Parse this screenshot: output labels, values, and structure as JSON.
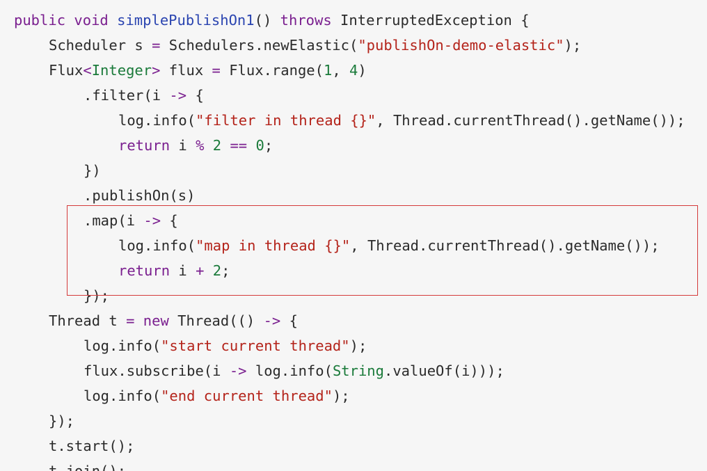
{
  "code": {
    "lines": [
      {
        "indent": 0,
        "tokens": [
          {
            "c": "kw",
            "t": "public"
          },
          {
            "c": "",
            "t": " "
          },
          {
            "c": "kw",
            "t": "void"
          },
          {
            "c": "",
            "t": " "
          },
          {
            "c": "fn",
            "t": "simplePublishOn1"
          },
          {
            "c": "",
            "t": "() "
          },
          {
            "c": "kw",
            "t": "throws"
          },
          {
            "c": "",
            "t": " InterruptedException {"
          }
        ]
      },
      {
        "indent": 1,
        "tokens": [
          {
            "c": "",
            "t": "Scheduler s "
          },
          {
            "c": "op",
            "t": "="
          },
          {
            "c": "",
            "t": " Schedulers.newElastic("
          },
          {
            "c": "str",
            "t": "\"publishOn-demo-elastic\""
          },
          {
            "c": "",
            "t": ");"
          }
        ]
      },
      {
        "indent": 1,
        "tokens": [
          {
            "c": "",
            "t": "Flux"
          },
          {
            "c": "op",
            "t": "<"
          },
          {
            "c": "ty",
            "t": "Integer"
          },
          {
            "c": "op",
            "t": ">"
          },
          {
            "c": "",
            "t": " flux "
          },
          {
            "c": "op",
            "t": "="
          },
          {
            "c": "",
            "t": " Flux.range("
          },
          {
            "c": "num",
            "t": "1"
          },
          {
            "c": "",
            "t": ", "
          },
          {
            "c": "num",
            "t": "4"
          },
          {
            "c": "",
            "t": ")"
          }
        ]
      },
      {
        "indent": 2,
        "tokens": [
          {
            "c": "",
            "t": ".filter(i "
          },
          {
            "c": "op",
            "t": "->"
          },
          {
            "c": "",
            "t": " {"
          }
        ]
      },
      {
        "indent": 3,
        "tokens": [
          {
            "c": "",
            "t": "log.info("
          },
          {
            "c": "str",
            "t": "\"filter in thread {}\""
          },
          {
            "c": "",
            "t": ", Thread.currentThread().getName());"
          }
        ]
      },
      {
        "indent": 3,
        "tokens": [
          {
            "c": "kw",
            "t": "return"
          },
          {
            "c": "",
            "t": " i "
          },
          {
            "c": "op",
            "t": "%"
          },
          {
            "c": "",
            "t": " "
          },
          {
            "c": "num",
            "t": "2"
          },
          {
            "c": "",
            "t": " "
          },
          {
            "c": "op",
            "t": "=="
          },
          {
            "c": "",
            "t": " "
          },
          {
            "c": "num",
            "t": "0"
          },
          {
            "c": "",
            "t": ";"
          }
        ]
      },
      {
        "indent": 2,
        "tokens": [
          {
            "c": "",
            "t": "})"
          }
        ]
      },
      {
        "indent": 2,
        "tokens": [
          {
            "c": "",
            "t": ".publishOn(s)"
          }
        ]
      },
      {
        "indent": 2,
        "tokens": [
          {
            "c": "",
            "t": ".map(i "
          },
          {
            "c": "op",
            "t": "->"
          },
          {
            "c": "",
            "t": " {"
          }
        ]
      },
      {
        "indent": 3,
        "tokens": [
          {
            "c": "",
            "t": "log.info("
          },
          {
            "c": "str",
            "t": "\"map in thread {}\""
          },
          {
            "c": "",
            "t": ", Thread.currentThread().getName());"
          }
        ]
      },
      {
        "indent": 3,
        "tokens": [
          {
            "c": "kw",
            "t": "return"
          },
          {
            "c": "",
            "t": " i "
          },
          {
            "c": "op",
            "t": "+"
          },
          {
            "c": "",
            "t": " "
          },
          {
            "c": "num",
            "t": "2"
          },
          {
            "c": "",
            "t": ";"
          }
        ]
      },
      {
        "indent": 2,
        "tokens": [
          {
            "c": "",
            "t": "});"
          }
        ]
      },
      {
        "indent": 1,
        "tokens": [
          {
            "c": "",
            "t": "Thread t "
          },
          {
            "c": "op",
            "t": "="
          },
          {
            "c": "",
            "t": " "
          },
          {
            "c": "kw",
            "t": "new"
          },
          {
            "c": "",
            "t": " Thread(() "
          },
          {
            "c": "op",
            "t": "->"
          },
          {
            "c": "",
            "t": " {"
          }
        ]
      },
      {
        "indent": 2,
        "tokens": [
          {
            "c": "",
            "t": "log.info("
          },
          {
            "c": "str",
            "t": "\"start current thread\""
          },
          {
            "c": "",
            "t": ");"
          }
        ]
      },
      {
        "indent": 2,
        "tokens": [
          {
            "c": "",
            "t": "flux.subscribe(i "
          },
          {
            "c": "op",
            "t": "->"
          },
          {
            "c": "",
            "t": " log.info("
          },
          {
            "c": "ty",
            "t": "String"
          },
          {
            "c": "",
            "t": ".valueOf(i)));"
          }
        ]
      },
      {
        "indent": 2,
        "tokens": [
          {
            "c": "",
            "t": "log.info("
          },
          {
            "c": "str",
            "t": "\"end current thread\""
          },
          {
            "c": "",
            "t": ");"
          }
        ]
      },
      {
        "indent": 1,
        "tokens": [
          {
            "c": "",
            "t": "});"
          }
        ]
      },
      {
        "indent": 1,
        "tokens": [
          {
            "c": "",
            "t": "t.start();"
          }
        ]
      },
      {
        "indent": 1,
        "tokens": [
          {
            "c": "",
            "t": "t.join();"
          }
        ]
      }
    ]
  },
  "colors": {
    "background": "#f6f6f6",
    "text": "#2b2b2b",
    "keyword": "#7a1f8f",
    "method_name": "#2a44b0",
    "string": "#b4231a",
    "number": "#1a7a3a",
    "highlight_border": "#d43a3a"
  }
}
